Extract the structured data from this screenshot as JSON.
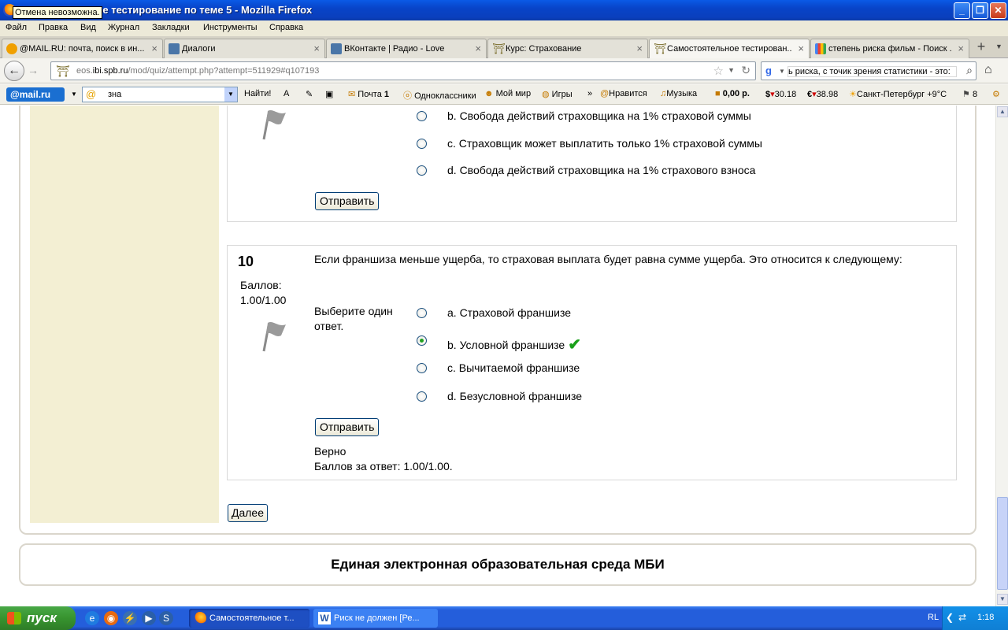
{
  "window": {
    "title": "Самостоятельное тестирование по теме 5 - Mozilla Firefox",
    "tooltip": "Отмена невозможна.",
    "min": "_",
    "max": "❐",
    "close": "✕"
  },
  "menu": [
    "Файл",
    "Правка",
    "Вид",
    "Журнал",
    "Закладки",
    "Инструменты",
    "Справка"
  ],
  "tabs": [
    {
      "label": "@MAIL.RU: почта, поиск в ин...",
      "icon": "mailru-icon"
    },
    {
      "label": "Диалоги",
      "icon": "dialog-icon"
    },
    {
      "label": "ВКонтакте | Радио - Love",
      "icon": "vk-icon"
    },
    {
      "label": "Курс: Страхование",
      "icon": "moodle-icon"
    },
    {
      "label": "Самостоятельное тестирован...",
      "icon": "moodle-icon",
      "active": true
    },
    {
      "label": "степень риска фильм - Поиск ...",
      "icon": "google-icon"
    }
  ],
  "nav": {
    "url_host": "eos.",
    "url_domain": "ibi.spb.ru",
    "url_path": "/mod/quiz/attempt.php?attempt=511929#q107193",
    "search_text": "ь риска, с точик зрения статистики - это:"
  },
  "mailbar": {
    "logo": "@mail.ru",
    "search_value": "зна",
    "find": "Найти!",
    "mail": "Почта",
    "mail_count": "1",
    "ok": "Одноклассники",
    "myworld": "Мой мир",
    "games": "Игры",
    "more": "»",
    "like": "Нравится",
    "music": "Музыка",
    "balance": "0,00 р.",
    "usd": "30.18",
    "eur": "38.98",
    "weather": "Санкт-Петербург +9°C",
    "traffic": "8"
  },
  "q9": {
    "options": [
      "b. Свобода действий страховщика на 1% страховой суммы",
      "c. Страховщик может выплатить только 1% страховой суммы",
      "d. Свобода действий страховщика на 1% страхового взноса"
    ],
    "submit": "Отправить"
  },
  "q10": {
    "number": "10",
    "grade_label": "Баллов:",
    "grade_value": "1.00/1.00",
    "text": "Если франшиза меньше ущерба, то страховая выплата будет равна сумме ущерба. Это относится к следующему:",
    "prompt": "Выберите один ответ.",
    "options": [
      {
        "label": "a. Страховой франшизе",
        "selected": false
      },
      {
        "label": "b. Условной франшизе",
        "selected": true,
        "correct": true
      },
      {
        "label": "c. Вычитаемой франшизе",
        "selected": false
      },
      {
        "label": "d. Безусловной франшизе",
        "selected": false
      }
    ],
    "submit": "Отправить",
    "feedback_status": "Верно",
    "feedback_score": "Баллов за ответ: 1.00/1.00."
  },
  "next_button": "Далее",
  "footer_text": "Единая электронная образовательная среда МБИ",
  "taskbar": {
    "start": "пуск",
    "tasks": [
      "Самостоятельное т...",
      "Риск не должен [Ре..."
    ],
    "lang": "RL",
    "time": "1:18"
  },
  "colors": {
    "accent_green": "#1aa01a",
    "sidebar_bg": "#f3efd3",
    "xp_blue": "#245edb"
  }
}
